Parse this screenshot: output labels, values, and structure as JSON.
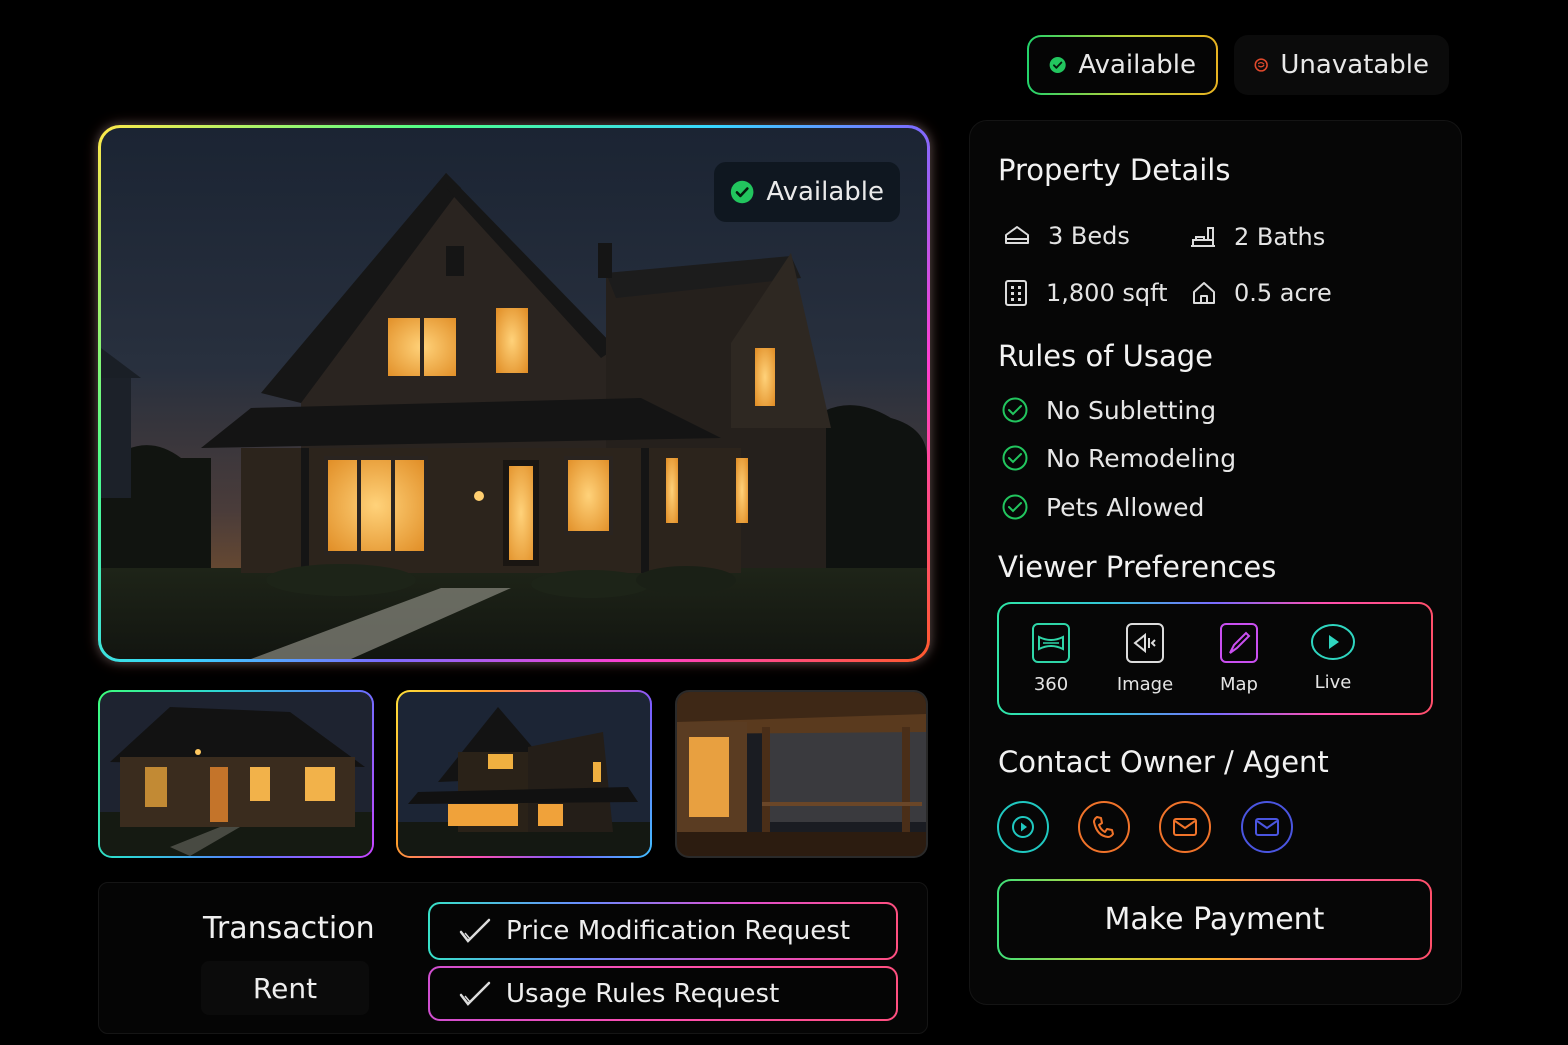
{
  "status_toggle": {
    "available_label": "Available",
    "unavailable_label": "Unavatable"
  },
  "hero": {
    "badge_label": "Available"
  },
  "transaction": {
    "title": "Transaction",
    "type": "Rent",
    "requests": [
      "Price Modification Request",
      "Usage Rules Request"
    ]
  },
  "property_details": {
    "title": "Property Details",
    "beds": "3 Beds",
    "baths": "2 Baths",
    "area": "1,800 sqft",
    "lot": "0.5 acre"
  },
  "rules": {
    "title": "Rules of Usage",
    "items": [
      "No Subletting",
      "No Remodeling",
      "Pets Allowed"
    ]
  },
  "viewer": {
    "title": "Viewer Preferences",
    "options": [
      "360",
      "Image",
      "Map",
      "Live"
    ]
  },
  "contact": {
    "title": "Contact Owner / Agent",
    "icons": [
      "play-icon",
      "phone-icon",
      "mail-icon",
      "mail-icon"
    ]
  },
  "payment": {
    "label": "Make Payment"
  },
  "colors": {
    "available_green": "#22c55e",
    "unavailable_red": "#e0492c",
    "cyan": "#20c8c0",
    "orange": "#f0732a",
    "indigo": "#4a55e0"
  }
}
